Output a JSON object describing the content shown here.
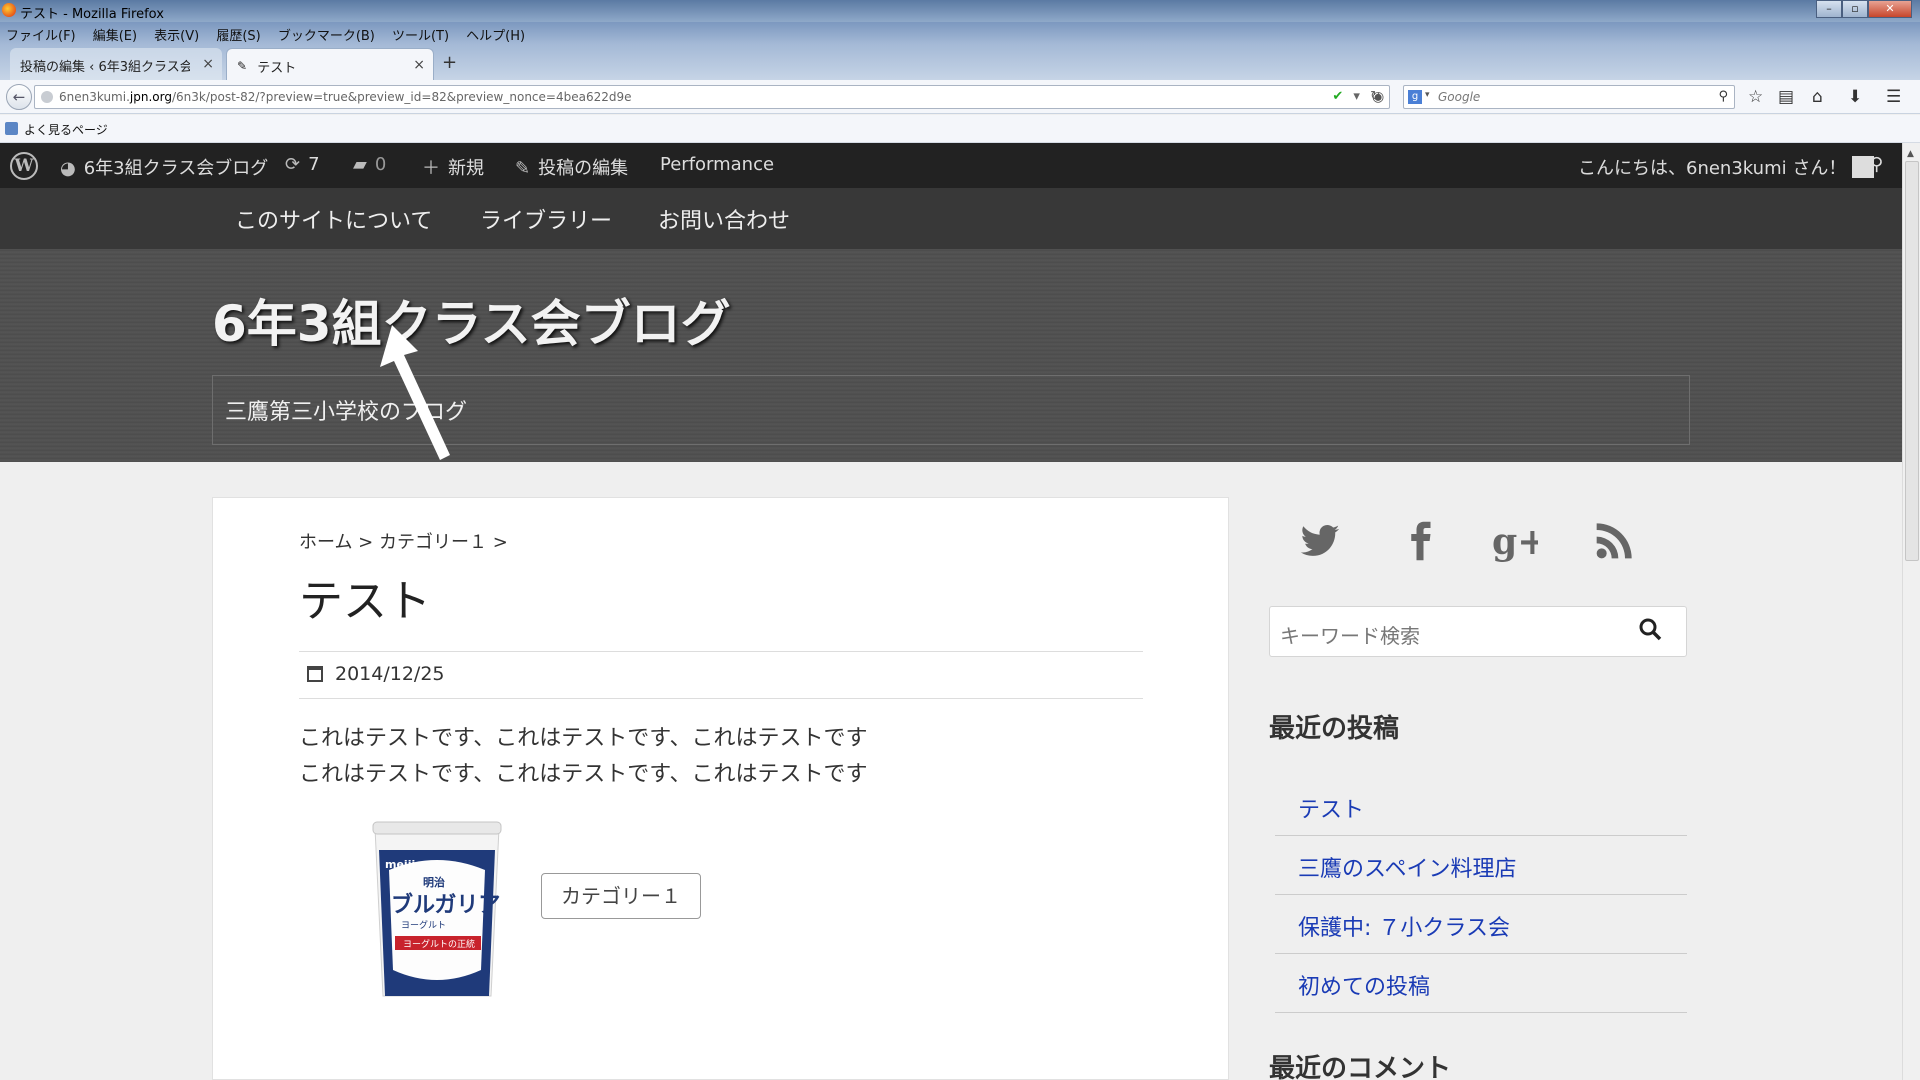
{
  "window": {
    "title": "テスト - Mozilla Firefox",
    "controls": [
      "–",
      "▫",
      "✕"
    ]
  },
  "menubar": [
    "ファイル(F)",
    "編集(E)",
    "表示(V)",
    "履歴(S)",
    "ブックマーク(B)",
    "ツール(T)",
    "ヘルプ(H)"
  ],
  "tabs": [
    {
      "label": "投稿の編集 ‹ 6年3組クラス会...",
      "close": "×"
    },
    {
      "label": "テスト",
      "close": "×"
    }
  ],
  "new_tab": "+",
  "navbar": {
    "url_prefix": "6nen3kumi.",
    "url_domain": "jpn.org",
    "url_rest": "/6n3k/post-82/?preview=true&preview_id=82&preview_nonce=4bea622d9e",
    "search_placeholder": "Google"
  },
  "bookmarks": {
    "label": "よく見るページ"
  },
  "adminbar": {
    "site_name": "6年3組クラス会ブログ",
    "updates": "7",
    "comments": "0",
    "new": "新規",
    "edit": "投稿の編集",
    "performance": "Performance",
    "greeting": "こんにちは、6nen3kumi さん！"
  },
  "sitenav": [
    "このサイトについて",
    "ライブラリー",
    "お問い合わせ"
  ],
  "header": {
    "site_title": "6年3組クラス会ブログ",
    "description": "三鷹第三小学校のブログ"
  },
  "post": {
    "breadcrumb": "ホーム > カテゴリー１ >",
    "title": "テスト",
    "date": "2014/12/25",
    "body": [
      "これはテストです、これはテストです、これはテストです",
      "これはテストです、これはテストです、これはテストです"
    ],
    "category_tag": "カテゴリー１",
    "image_text": {
      "brand": "meiji",
      "line1": "明治",
      "line2": "ブルガリア",
      "line3": "ヨーグルト",
      "line4": "ヨーグルトの正統"
    }
  },
  "sidebar": {
    "search_placeholder": "キーワード検索",
    "recent_posts_title": "最近の投稿",
    "recent_posts": [
      "テスト",
      "三鷹のスペイン料理店",
      "保護中: ７小クラス会",
      "初めての投稿"
    ],
    "recent_comments_title": "最近のコメント"
  },
  "colors": {
    "adminbar": "#222222",
    "sitenav": "#383838",
    "header": "#4e4e4e",
    "link": "#1a3bb5"
  }
}
